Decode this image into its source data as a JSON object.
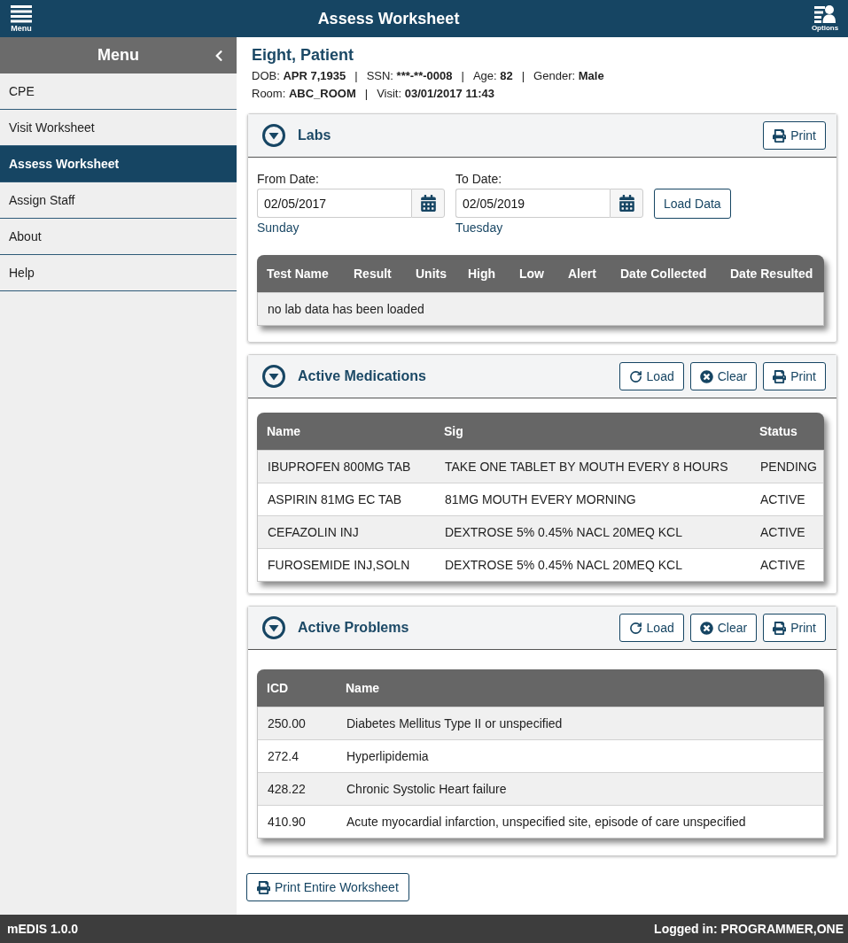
{
  "header": {
    "menu_label": "Menu",
    "title": "Assess Worksheet",
    "options_label": "Options"
  },
  "sidebar": {
    "title": "Menu",
    "items": [
      {
        "label": "CPE",
        "selected": false
      },
      {
        "label": "Visit Worksheet",
        "selected": false
      },
      {
        "label": "Assess Worksheet",
        "selected": true
      },
      {
        "label": "Assign Staff",
        "selected": false
      },
      {
        "label": "About",
        "selected": false
      },
      {
        "label": "Help",
        "selected": false
      }
    ]
  },
  "patient": {
    "name": "Eight, Patient",
    "lines": [
      [
        {
          "kind": "field",
          "label": "DOB:",
          "value": "APR 7,1935"
        },
        {
          "kind": "separator",
          "text": "|"
        },
        {
          "kind": "field",
          "label": "SSN:",
          "value": "***-**-0008"
        },
        {
          "kind": "separator",
          "text": "|"
        },
        {
          "kind": "field",
          "label": "Age:",
          "value": "82"
        },
        {
          "kind": "separator",
          "text": "|"
        },
        {
          "kind": "field",
          "label": "Gender:",
          "value": "Male"
        }
      ],
      [
        {
          "kind": "field",
          "label": "Room:",
          "value": "ABC_ROOM"
        },
        {
          "kind": "separator",
          "text": "|"
        },
        {
          "kind": "field",
          "label": "Visit:",
          "value": "03/01/2017 11:43"
        }
      ]
    ]
  },
  "labs": {
    "title": "Labs",
    "buttons": [
      {
        "kind": "print",
        "label": "Print"
      }
    ],
    "dates": [
      {
        "label": "From Date:",
        "value": "02/05/2017",
        "day": "Sunday"
      },
      {
        "label": "To Date:",
        "value": "02/05/2019",
        "day": "Tuesday"
      }
    ],
    "load_button": "Load Data",
    "table": {
      "columns": [
        "Test Name",
        "Result",
        "Units",
        "High",
        "Low",
        "Alert",
        "Date Collected",
        "Date Resulted"
      ],
      "empty_message": "no lab data has been loaded"
    }
  },
  "medications": {
    "title": "Active Medications",
    "buttons": [
      {
        "kind": "load",
        "label": "Load"
      },
      {
        "kind": "clear",
        "label": "Clear"
      },
      {
        "kind": "print",
        "label": "Print"
      }
    ],
    "table": {
      "columns": [
        "Name",
        "Sig",
        "Status"
      ],
      "rows": [
        [
          "IBUPROFEN 800MG TAB",
          "TAKE ONE TABLET BY MOUTH EVERY 8 HOURS",
          "PENDING"
        ],
        [
          "ASPIRIN 81MG EC TAB",
          "81MG MOUTH EVERY MORNING",
          "ACTIVE"
        ],
        [
          "CEFAZOLIN INJ",
          "DEXTROSE 5% 0.45% NACL 20MEQ KCL",
          "ACTIVE"
        ],
        [
          "FUROSEMIDE INJ,SOLN",
          "DEXTROSE 5% 0.45% NACL 20MEQ KCL",
          "ACTIVE"
        ]
      ]
    }
  },
  "problems": {
    "title": "Active Problems",
    "buttons": [
      {
        "kind": "load",
        "label": "Load"
      },
      {
        "kind": "clear",
        "label": "Clear"
      },
      {
        "kind": "print",
        "label": "Print"
      }
    ],
    "table": {
      "columns": [
        "ICD",
        "Name"
      ],
      "rows": [
        [
          "250.00",
          "Diabetes Mellitus Type II or unspecified"
        ],
        [
          "272.4",
          "Hyperlipidemia"
        ],
        [
          "428.22",
          "Chronic Systolic Heart failure"
        ],
        [
          "410.90",
          "Acute myocardial infarction, unspecified site, episode of care unspecified"
        ]
      ]
    }
  },
  "print_all_button": "Print Entire Worksheet",
  "footer": {
    "version": "mEDIS 1.0.0",
    "user": "Logged in: PROGRAMMER,ONE"
  }
}
